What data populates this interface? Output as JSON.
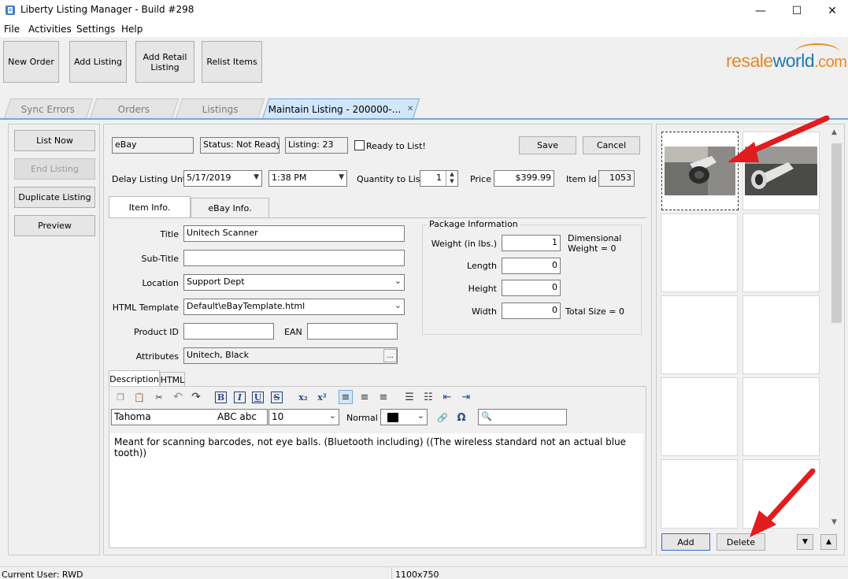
{
  "window": {
    "title": "Liberty Listing Manager - Build #298",
    "minimize": "—",
    "maximize": "☐",
    "close": "✕"
  },
  "menu": [
    "File",
    "Activities",
    "Settings",
    "Help"
  ],
  "toolbar": {
    "new_order": "New Order",
    "add_listing": "Add Listing",
    "add_retail_listing": "Add Retail Listing",
    "relist_items": "Relist Items"
  },
  "logo": {
    "part1": "resale",
    "part2": "world",
    "part3": ".com"
  },
  "tabs": [
    {
      "label": "Sync Errors"
    },
    {
      "label": "Orders"
    },
    {
      "label": "Listings"
    },
    {
      "label": "Maintain Listing - 200000-...",
      "close": "✕"
    }
  ],
  "left_buttons": {
    "list_now": "List Now",
    "end_listing": "End Listing",
    "duplicate_listing": "Duplicate Listing",
    "preview": "Preview"
  },
  "header": {
    "marketplace": "eBay",
    "status": "Status: Not Ready",
    "listing": "Listing: 23",
    "ready_label": "Ready to List!",
    "save": "Save",
    "cancel": "Cancel"
  },
  "listing_row": {
    "delay_label": "Delay Listing Until",
    "date": "5/17/2019",
    "time": "1:38 PM",
    "qty_label": "Quantity to List",
    "qty": "1",
    "price_label": "Price",
    "price": "$399.99",
    "item_id_label": "Item Id",
    "item_id": "1053"
  },
  "subtabs": {
    "item_info": "Item Info.",
    "ebay_info": "eBay Info."
  },
  "fields": {
    "title_label": "Title",
    "title": "Unitech Scanner",
    "subtitle_label": "Sub-Title",
    "subtitle": "",
    "location_label": "Location",
    "location": "Support Dept",
    "template_label": "HTML Template",
    "template": "Default\\eBayTemplate.html",
    "product_id_label": "Product ID",
    "product_id": "",
    "ean_label": "EAN",
    "ean": "",
    "attributes_label": "Attributes",
    "attributes": "Unitech, Black",
    "attributes_btn": "..."
  },
  "package": {
    "title": "Package Information",
    "weight_label": "Weight (in lbs.)",
    "weight": "1",
    "dimensional": "Dimensional Weight = 0",
    "length_label": "Length",
    "length": "0",
    "height_label": "Height",
    "height": "0",
    "width_label": "Width",
    "width": "0",
    "total_size": "Total Size = 0"
  },
  "editor": {
    "tab_description": "Description",
    "tab_html": "HTML",
    "font": "Tahoma",
    "font_preview": "ABC abc",
    "size": "10",
    "style": "Normal",
    "content": "Meant for scanning barcodes, not eye balls. (Bluetooth including) ((The wireless standard not an actual blue tooth))"
  },
  "images": {
    "add": "Add",
    "delete": "Delete"
  },
  "status": {
    "user": "Current User: RWD",
    "resolution": "1100x750"
  },
  "colors": {
    "accent_tab": "#cfe6fb",
    "arrow": "#e21c1c",
    "logo_orange": "#e9871f",
    "logo_blue": "#1e78b4"
  }
}
